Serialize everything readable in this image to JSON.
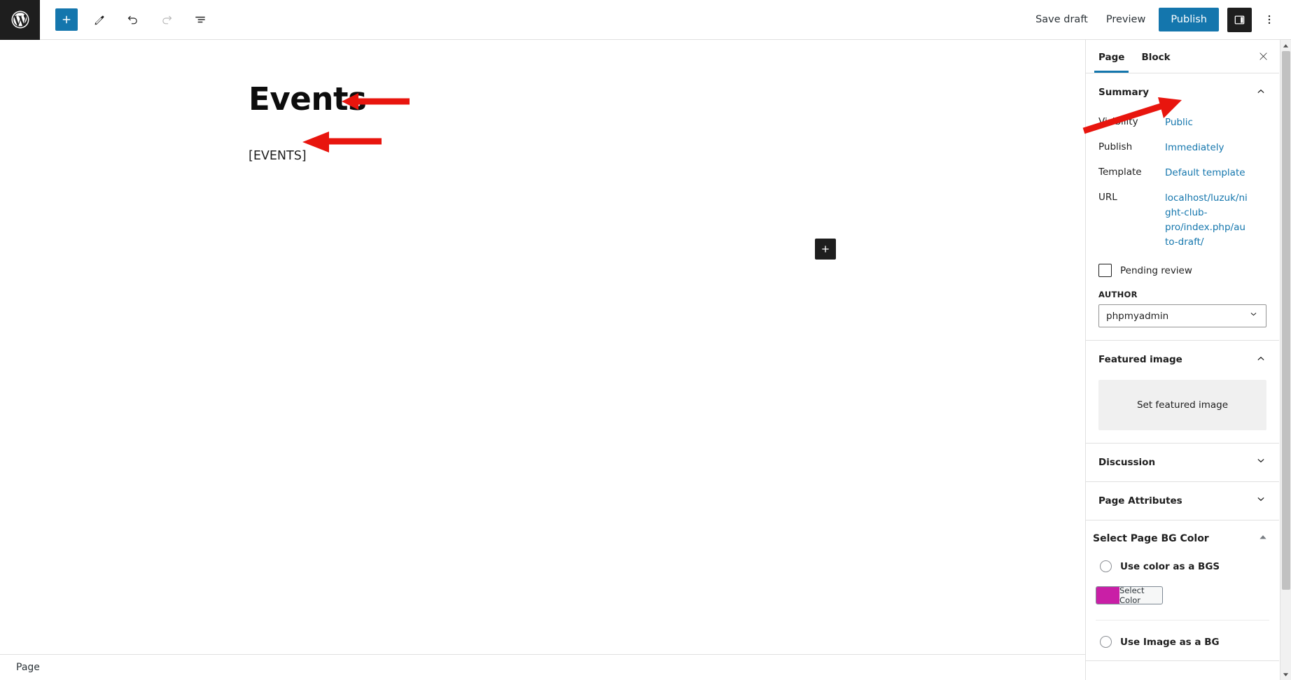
{
  "toolbar": {
    "logo_icon": "wordpress-logo",
    "inserter_label": "+",
    "tools_icon": "pencil-icon",
    "undo_icon": "undo-icon",
    "redo_icon": "redo-icon",
    "listview_icon": "list-view-icon",
    "save_draft": "Save draft",
    "preview": "Preview",
    "publish": "Publish",
    "sidebar_toggle_icon": "settings-sidebar-icon",
    "more_icon": "more-options-icon",
    "accent_blue": "#1476ad"
  },
  "canvas": {
    "title": "Events",
    "paragraph": "[EVENTS]",
    "inserter_label": "+"
  },
  "statusbar": {
    "label": "Page"
  },
  "sidebar": {
    "tabs": [
      {
        "label": "Page",
        "active": true
      },
      {
        "label": "Block",
        "active": false
      }
    ],
    "close_icon": "close-icon",
    "summary": {
      "title": "Summary",
      "chevron": "chevron-up-icon",
      "rows": [
        {
          "label": "Visibility",
          "value": "Public"
        },
        {
          "label": "Publish",
          "value": "Immediately"
        },
        {
          "label": "Template",
          "value": "Default template"
        },
        {
          "label": "URL",
          "value": "localhost/luzuk/night-club-pro/index.php/auto-draft/"
        }
      ],
      "pending_review": "Pending review",
      "author_label": "AUTHOR",
      "author_value": "phpmyadmin",
      "author_chevron": "chevron-down-icon"
    },
    "featured_image": {
      "title": "Featured image",
      "chevron": "chevron-up-icon",
      "placeholder": "Set featured image"
    },
    "discussion": {
      "title": "Discussion",
      "chevron": "chevron-down-icon"
    },
    "page_attributes": {
      "title": "Page Attributes",
      "chevron": "chevron-down-icon"
    },
    "bg_color": {
      "title": "Select Page BG Color",
      "chevron": "triangle-up-icon",
      "option_color": "Use color as a BGS",
      "select_color_label": "Select Color",
      "swatch_hex": "#c91fa6",
      "option_image": "Use Image as a BG"
    }
  },
  "scrollbar": {
    "up_icon": "scroll-up-arrow",
    "down_icon": "scroll-down-arrow"
  },
  "annotations": {
    "arrow_color": "#e8150e",
    "arrows": [
      {
        "name": "arrow-to-title",
        "points_at": "Events"
      },
      {
        "name": "arrow-to-shortcode",
        "points_at": "[EVENTS]"
      },
      {
        "name": "arrow-to-visibility-public",
        "points_at": "Public"
      }
    ]
  }
}
